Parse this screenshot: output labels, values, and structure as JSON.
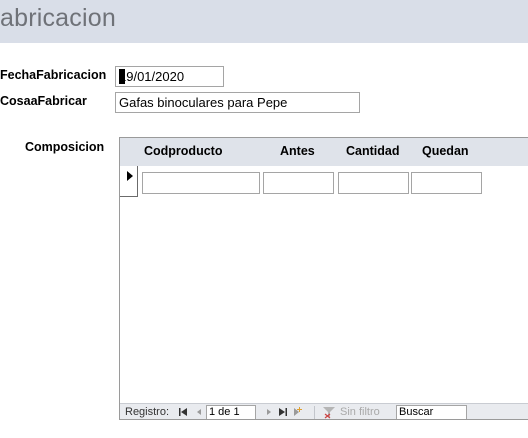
{
  "header": {
    "title": "abricacion"
  },
  "form": {
    "fecha_label": "FechaFabricacion",
    "fecha_value": "19/01/2020",
    "cosa_label": "CosaaFabricar",
    "cosa_value": "Gafas binoculares para Pepe",
    "composicion_label": "Composicion"
  },
  "subform": {
    "columns": [
      "Codproducto",
      "Antes",
      "Cantidad",
      "Quedan"
    ],
    "rows": [
      {
        "codproducto": "",
        "antes": "",
        "cantidad": "",
        "quedan": ""
      }
    ]
  },
  "navigation": {
    "registro_label": "Registro:",
    "position": "1 de 1",
    "filter_label": "Sin filtro",
    "search_placeholder": "Buscar",
    "icons": [
      "first-record-icon",
      "prev-record-icon",
      "next-record-icon",
      "last-record-icon",
      "new-record-icon",
      "filter-icon"
    ]
  }
}
